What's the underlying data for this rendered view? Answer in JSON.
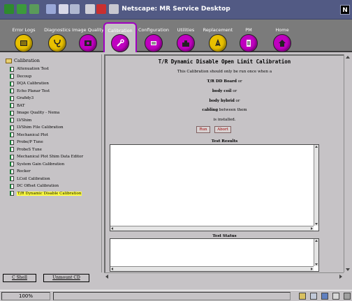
{
  "window": {
    "title": "Netscape: MR Service Desktop",
    "logo_letter": "N"
  },
  "toolbar_icons": [
    "back-icon",
    "forward-icon",
    "reload-icon",
    "home-icon",
    "search-icon",
    "images-icon",
    "print-icon",
    "security-icon",
    "stop-icon"
  ],
  "tabs": [
    {
      "label": "Error Logs",
      "icon": "error-log-icon",
      "color": "#e8c000"
    },
    {
      "label": "Diagnostics",
      "icon": "stethoscope-icon",
      "color": "#e8c000"
    },
    {
      "label": "Image Quality",
      "icon": "image-quality-icon",
      "color": "#c000c0"
    },
    {
      "label": "Calibration",
      "icon": "calibration-icon",
      "color": "#c000c0",
      "active": true
    },
    {
      "label": "Configuration",
      "icon": "configuration-icon",
      "color": "#c000c0"
    },
    {
      "label": "Utilities",
      "icon": "utilities-icon",
      "color": "#c000c0"
    },
    {
      "label": "Replacement",
      "icon": "replacement-icon",
      "color": "#e8c000"
    },
    {
      "label": "PM",
      "icon": "pm-icon",
      "color": "#c000c0"
    },
    {
      "label": "Home",
      "icon": "home-icon",
      "color": "#c000c0"
    }
  ],
  "tree": {
    "root": "Calibration",
    "items": [
      "Attenuation Test",
      "Decoup",
      "DQA Calibration",
      "Echo Planar Test",
      "Grafidy3",
      "BAT",
      "Image Quality - Nema",
      "LVShim",
      "LVShim File Calibration",
      "Mechanical Plot",
      "Probe/P Tune",
      "ProbeS Tune",
      "Mechanical Plot Shim Data Editor",
      "System Gain Calibration",
      "Rocker",
      "LCoil Calibration",
      "DC Offset Calibration",
      "T/R Dynamic Disable Calibration"
    ],
    "selected_index": 17
  },
  "bottom_buttons": {
    "cshell": "C Shell",
    "unmount": "Unmount CD"
  },
  "content": {
    "title": "T/R Dynamic Disable Open Limit Calibration",
    "line1": "This Calibration should only be run once when a",
    "line2_bold": "T/R DD Board",
    "line2_rest": " or",
    "line3_bold": "body coil",
    "line3_rest": " or",
    "line4_bold": "body hybrid",
    "line4_rest": " or",
    "line5_bold": "cabling",
    "line5_rest": " between them",
    "line6": "is installed.",
    "run_label": "Run",
    "abort_label": "Abort",
    "results_label": "Test Results",
    "status_label": "Test Status"
  },
  "statusbar": {
    "zoom": "100%"
  },
  "colors": {
    "active_tab_border": "#a000c0",
    "titlebar": "#525a84",
    "nav_band": "#7b7b7b",
    "selection": "#ffff40",
    "button_text": "#a00000"
  }
}
